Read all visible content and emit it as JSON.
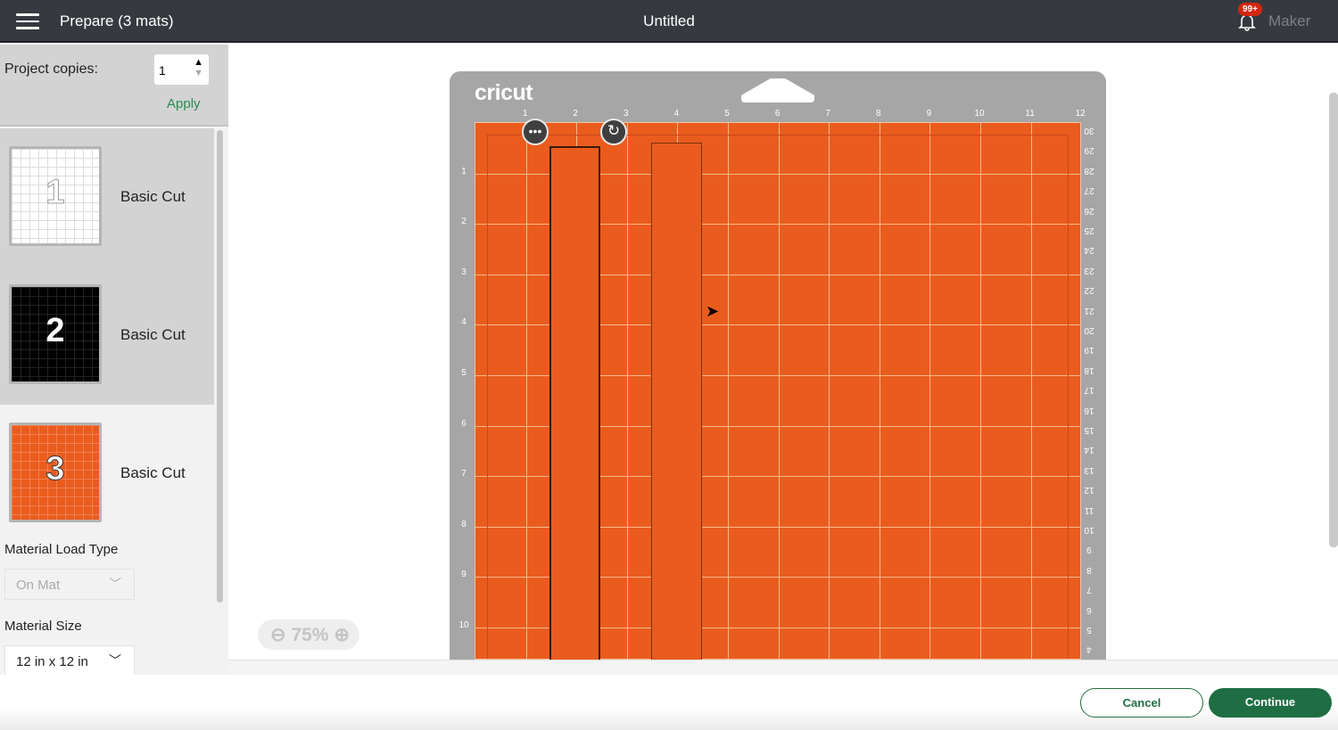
{
  "header": {
    "title": "Prepare (3 mats)",
    "document": "Untitled",
    "notification_count": "99+",
    "user": "Maker"
  },
  "sidebar": {
    "copies_label": "Project copies:",
    "copies_value": "1",
    "apply": "Apply",
    "mats": [
      {
        "number": "1",
        "label": "Basic Cut",
        "color": "#ffffff"
      },
      {
        "number": "2",
        "label": "Basic Cut",
        "color": "#000000"
      },
      {
        "number": "3",
        "label": "Basic Cut",
        "color": "#ea5c1e"
      }
    ],
    "load_type_label": "Material Load Type",
    "load_type_value": "On Mat",
    "size_label": "Material Size",
    "size_value": "12 in x 12 in"
  },
  "canvas": {
    "logo": "cricut",
    "mat_color": "#ea5c1e",
    "top_ticks": [
      "1",
      "2",
      "3",
      "4",
      "5",
      "6",
      "7",
      "8",
      "9",
      "10",
      "11",
      "12"
    ],
    "left_ticks": [
      "1",
      "2",
      "3",
      "4",
      "5",
      "6",
      "7",
      "8",
      "9",
      "10"
    ],
    "right_ticks": [
      "30",
      "29",
      "28",
      "27",
      "26",
      "25",
      "24",
      "23",
      "22",
      "21",
      "20",
      "19",
      "18",
      "17",
      "16",
      "15",
      "14",
      "13",
      "12",
      "11",
      "10",
      "9",
      "8",
      "7",
      "6",
      "5",
      "4"
    ],
    "zoom": "75%"
  },
  "footer": {
    "cancel": "Cancel",
    "continue": "Continue"
  }
}
